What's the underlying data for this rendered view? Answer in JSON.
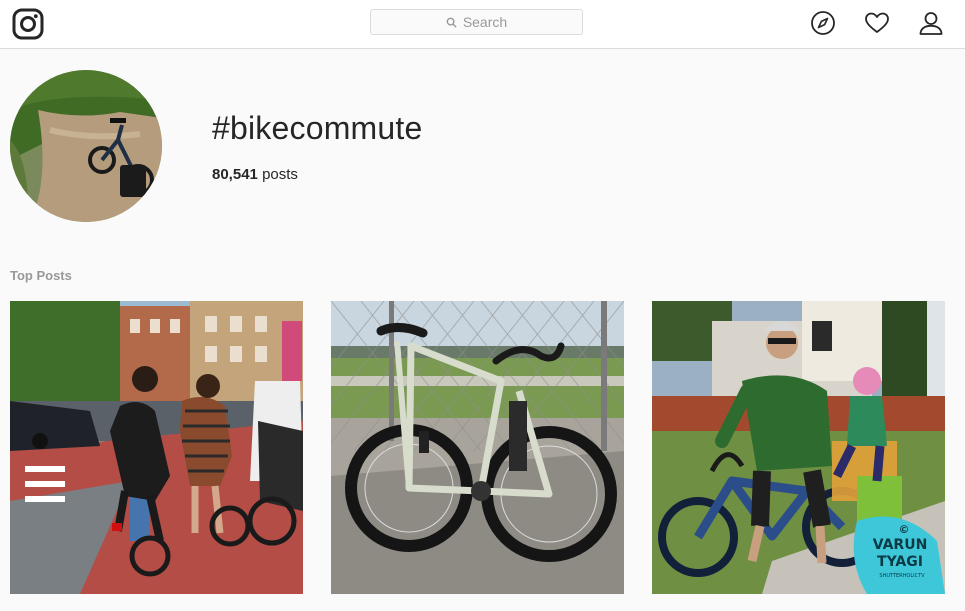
{
  "header": {
    "logo_icon": "instagram-camera-icon",
    "search": {
      "placeholder": "Search",
      "icon": "search-icon"
    },
    "nav": [
      {
        "name": "explore",
        "icon": "compass-icon"
      },
      {
        "name": "activity",
        "icon": "heart-icon"
      },
      {
        "name": "profile",
        "icon": "person-icon"
      }
    ]
  },
  "profile": {
    "hashtag": "#bikecommute",
    "post_count": "80,541",
    "post_label": "posts"
  },
  "top_posts": {
    "title": "Top Posts",
    "items": [
      {
        "description": "cyclists on a red bike lane in a city street"
      },
      {
        "description": "gravel bike leaning on a chain-link fence"
      },
      {
        "description": "man with child seat on a blue cruiser bike"
      }
    ],
    "watermark": {
      "symbol": "©",
      "line1": "VARUN",
      "line2": "TYAGI",
      "line3": "SHUTTERHOLICTV"
    }
  },
  "colors": {
    "background": "#fafafa",
    "border": "#dbdbdb",
    "text": "#262626",
    "muted": "#999999"
  }
}
